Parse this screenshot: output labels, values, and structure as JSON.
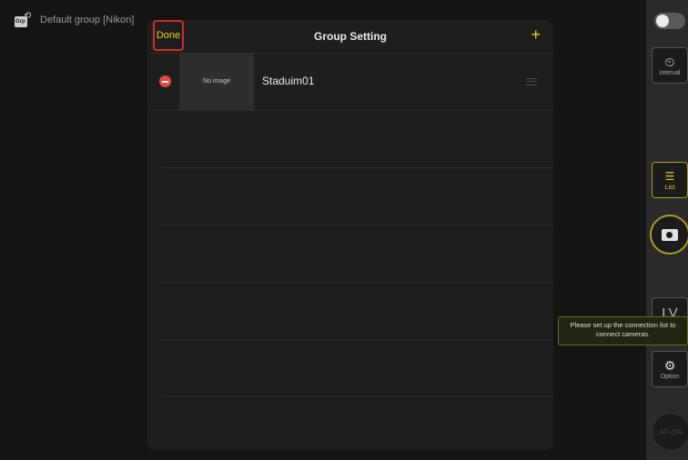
{
  "group": {
    "label": "Default group [Nikon]",
    "icon": "group-camera-icon",
    "icon_text": "Grp"
  },
  "modal": {
    "title": "Group Setting",
    "done_label": "Done",
    "add_label": "+",
    "rows": [
      {
        "thumbnail_text": "No image",
        "name": "Staduim01"
      }
    ]
  },
  "rail": {
    "interval_label": "Interval",
    "list_label": "List",
    "lv_label": "LV",
    "option_label": "Option",
    "af_on_label": "AF-ON",
    "tooltip": "Please set up the connection list to connect cameras."
  },
  "colors": {
    "accent": "#e8d21d",
    "highlight": "#d42c2c",
    "remove": "#e34a3f"
  }
}
